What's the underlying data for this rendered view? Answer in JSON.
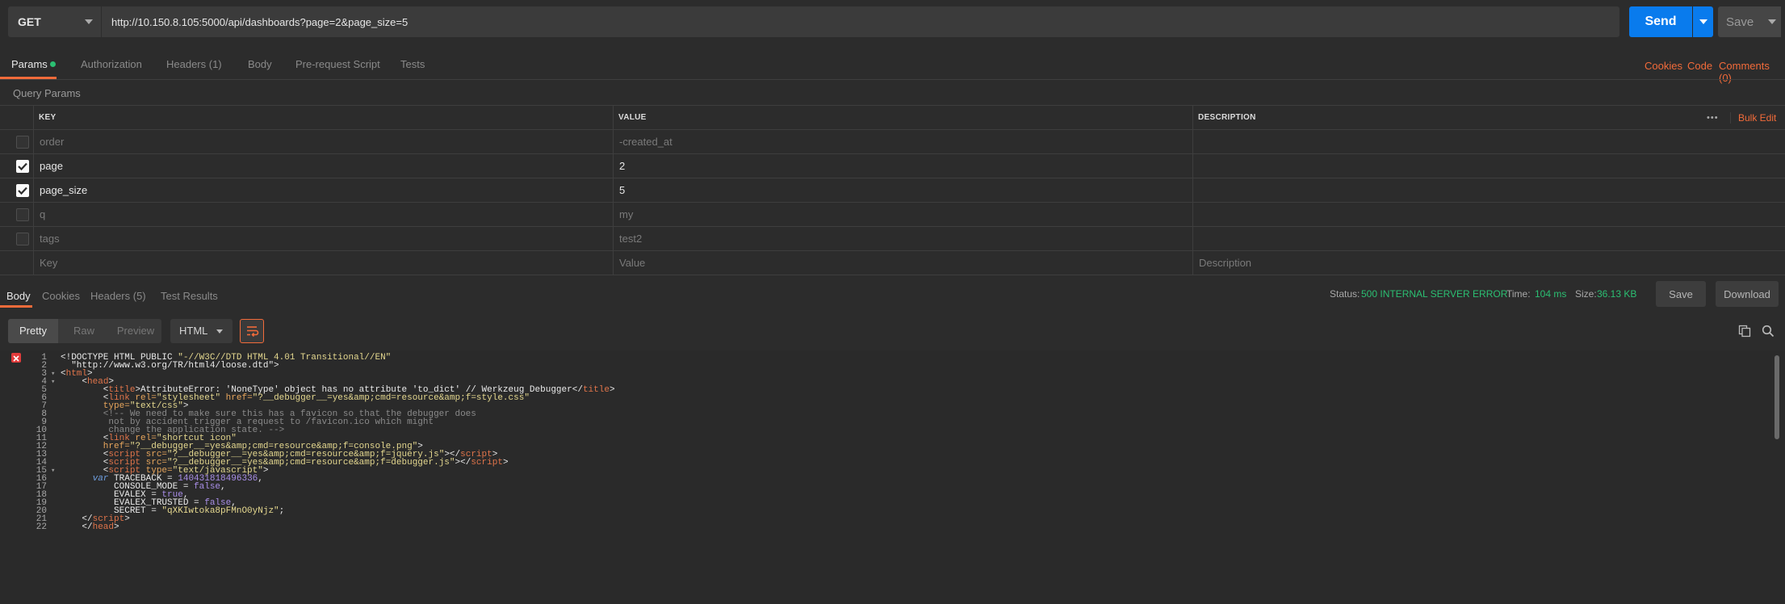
{
  "request": {
    "method": "GET",
    "url": "http://10.150.8.105:5000/api/dashboards?page=2&page_size=5",
    "send_label": "Send",
    "save_label": "Save"
  },
  "request_tabs": [
    {
      "label": "Params",
      "active": true
    },
    {
      "label": "Authorization"
    },
    {
      "label": "Headers (1)"
    },
    {
      "label": "Body"
    },
    {
      "label": "Pre-request Script"
    },
    {
      "label": "Tests"
    }
  ],
  "request_links": {
    "cookies": "Cookies",
    "code": "Code",
    "comments": "Comments (0)"
  },
  "query_params": {
    "title": "Query Params",
    "columns": {
      "key": "KEY",
      "value": "VALUE",
      "description": "DESCRIPTION"
    },
    "bulk_edit": "Bulk Edit",
    "more": "•••",
    "rows": [
      {
        "key": "order",
        "value": "-created_at",
        "checked": false
      },
      {
        "key": "page",
        "value": "2",
        "checked": true
      },
      {
        "key": "page_size",
        "value": "5",
        "checked": true
      },
      {
        "key": "q",
        "value": "my",
        "checked": false
      },
      {
        "key": "tags",
        "value": "test2",
        "checked": false
      }
    ],
    "placeholder": {
      "key": "Key",
      "value": "Value",
      "description": "Description"
    }
  },
  "response_tabs": [
    {
      "label": "Body",
      "active": true
    },
    {
      "label": "Cookies"
    },
    {
      "label": "Headers (5)"
    },
    {
      "label": "Test Results"
    }
  ],
  "response_meta": {
    "status_label": "Status:",
    "status": "500 INTERNAL SERVER ERROR",
    "time_label": "Time:",
    "time": "104 ms",
    "size_label": "Size:",
    "size": "36.13 KB",
    "save_label": "Save",
    "download_label": "Download"
  },
  "view": {
    "modes": [
      "Pretty",
      "Raw",
      "Preview"
    ],
    "active_mode": "Pretty",
    "format": "HTML"
  },
  "code": {
    "line_numbers": [
      "1",
      "2",
      "3",
      "4",
      "5",
      "6",
      "7",
      "8",
      "9",
      "10",
      "11",
      "12",
      "13",
      "14",
      "15",
      "16",
      "17",
      "18",
      "19",
      "20",
      "21",
      "22"
    ],
    "fold_lines": [
      3,
      4,
      15
    ],
    "lines": [
      [
        {
          "t": "<!DOCTYPE HTML PUBLIC ",
          "c": ""
        },
        {
          "t": "\"-//W3C//DTD HTML 4.01 Transitional//EN\"",
          "c": "t-str"
        }
      ],
      [
        {
          "t": "  \"http://www.w3.org/TR/html4/loose.dtd\">",
          "c": ""
        }
      ],
      [
        {
          "t": "<",
          "c": ""
        },
        {
          "t": "html",
          "c": "t-tag"
        },
        {
          "t": ">",
          "c": ""
        }
      ],
      [
        {
          "t": "    <",
          "c": ""
        },
        {
          "t": "head",
          "c": "t-tag"
        },
        {
          "t": ">",
          "c": ""
        }
      ],
      [
        {
          "t": "        <",
          "c": ""
        },
        {
          "t": "title",
          "c": "t-tag"
        },
        {
          "t": ">AttributeError: 'NoneType' object has no attribute 'to_dict' // Werkzeug Debugger</",
          "c": ""
        },
        {
          "t": "title",
          "c": "t-tag"
        },
        {
          "t": ">",
          "c": ""
        }
      ],
      [
        {
          "t": "        <",
          "c": ""
        },
        {
          "t": "link",
          "c": "t-tag"
        },
        {
          "t": " rel=",
          "c": "t-attr"
        },
        {
          "t": "\"stylesheet\"",
          "c": "t-str"
        },
        {
          "t": " href=",
          "c": "t-attr"
        },
        {
          "t": "\"?__debugger__=yes&amp;cmd=resource&amp;f=style.css\"",
          "c": "t-str"
        }
      ],
      [
        {
          "t": "        type=",
          "c": "t-attr"
        },
        {
          "t": "\"text/css\"",
          "c": "t-str"
        },
        {
          "t": ">",
          "c": ""
        }
      ],
      [
        {
          "t": "        <!-- We need to make sure this has a favicon so that the debugger does",
          "c": "t-cmt"
        }
      ],
      [
        {
          "t": "         not by accident trigger a request to /favicon.ico which might",
          "c": "t-cmt"
        }
      ],
      [
        {
          "t": "         change the application state. -->",
          "c": "t-cmt"
        }
      ],
      [
        {
          "t": "        <",
          "c": ""
        },
        {
          "t": "link",
          "c": "t-tag"
        },
        {
          "t": " rel=",
          "c": "t-attr"
        },
        {
          "t": "\"shortcut icon\"",
          "c": "t-str"
        }
      ],
      [
        {
          "t": "        href=",
          "c": "t-attr"
        },
        {
          "t": "\"?__debugger__=yes&amp;cmd=resource&amp;f=console.png\"",
          "c": "t-str"
        },
        {
          "t": ">",
          "c": ""
        }
      ],
      [
        {
          "t": "        <",
          "c": ""
        },
        {
          "t": "script",
          "c": "t-tag"
        },
        {
          "t": " src=",
          "c": "t-attr"
        },
        {
          "t": "\"?__debugger__=yes&amp;cmd=resource&amp;f=jquery.js\"",
          "c": "t-str"
        },
        {
          "t": "></",
          "c": ""
        },
        {
          "t": "script",
          "c": "t-tag"
        },
        {
          "t": ">",
          "c": ""
        }
      ],
      [
        {
          "t": "        <",
          "c": ""
        },
        {
          "t": "script",
          "c": "t-tag"
        },
        {
          "t": " src=",
          "c": "t-attr"
        },
        {
          "t": "\"?__debugger__=yes&amp;cmd=resource&amp;f=debugger.js\"",
          "c": "t-str"
        },
        {
          "t": "></",
          "c": ""
        },
        {
          "t": "script",
          "c": "t-tag"
        },
        {
          "t": ">",
          "c": ""
        }
      ],
      [
        {
          "t": "        <",
          "c": ""
        },
        {
          "t": "script",
          "c": "t-tag"
        },
        {
          "t": " type=",
          "c": "t-attr"
        },
        {
          "t": "\"text/javascript\"",
          "c": "t-str"
        },
        {
          "t": ">",
          "c": ""
        }
      ],
      [
        {
          "t": "      ",
          "c": ""
        },
        {
          "t": "var",
          "c": "t-kw"
        },
        {
          "t": " TRACEBACK = ",
          "c": ""
        },
        {
          "t": "140431818496336",
          "c": "t-num"
        },
        {
          "t": ",",
          "c": ""
        }
      ],
      [
        {
          "t": "          CONSOLE_MODE = ",
          "c": ""
        },
        {
          "t": "false",
          "c": "t-num"
        },
        {
          "t": ",",
          "c": ""
        }
      ],
      [
        {
          "t": "          EVALEX = ",
          "c": ""
        },
        {
          "t": "true",
          "c": "t-num"
        },
        {
          "t": ",",
          "c": ""
        }
      ],
      [
        {
          "t": "          EVALEX_TRUSTED = ",
          "c": ""
        },
        {
          "t": "false",
          "c": "t-num"
        },
        {
          "t": ",",
          "c": ""
        }
      ],
      [
        {
          "t": "          SECRET = ",
          "c": ""
        },
        {
          "t": "\"qXKIwtoka8pFMnO0yNjz\"",
          "c": "t-str"
        },
        {
          "t": ";",
          "c": ""
        }
      ],
      [
        {
          "t": "    </",
          "c": ""
        },
        {
          "t": "script",
          "c": "t-tag"
        },
        {
          "t": ">",
          "c": ""
        }
      ],
      [
        {
          "t": "    </",
          "c": ""
        },
        {
          "t": "head",
          "c": "t-tag"
        },
        {
          "t": ">",
          "c": ""
        }
      ]
    ]
  },
  "colors": {
    "accent": "#f26b3a",
    "send": "#097bed",
    "status_green": "#2bbf72",
    "background": "#2c2c2c"
  },
  "icons": {
    "copy": "copy-icon",
    "search": "search-icon",
    "wrap": "wrap-lines-icon",
    "error": "error-icon",
    "check": "checkbox-checked-icon"
  }
}
